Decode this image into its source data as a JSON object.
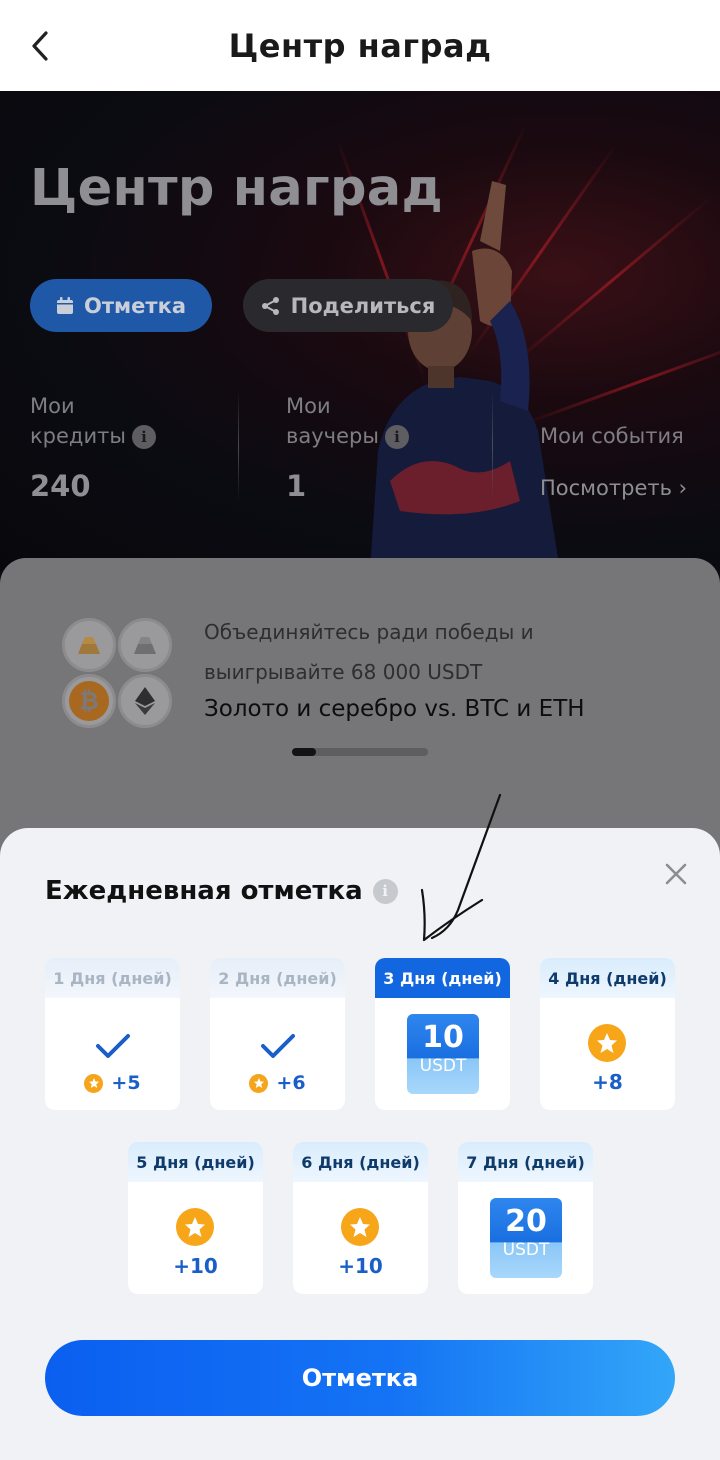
{
  "topbar": {
    "title": "Центр наград"
  },
  "hero": {
    "title": "Центр наград",
    "checkin_label": "Отметка",
    "share_label": "Поделиться",
    "credits": {
      "label_line1": "Мои",
      "label_line2": "кредиты",
      "value": "240"
    },
    "vouchers": {
      "label_line1": "Мои",
      "label_line2": "ваучеры",
      "value": "1"
    },
    "events": {
      "label": "Мои события",
      "link": "Посмотреть ›"
    }
  },
  "promo": {
    "subtitle_line1": "Объединяйтесь ради победы и",
    "subtitle_line2": "выигрывайте 68 000 USDT",
    "title": "Золото и серебро vs. BTC и ETH"
  },
  "daily_checkin": {
    "title": "Ежедневная отметка",
    "days": [
      {
        "label": "1 Дня (дней)",
        "status": "claimed",
        "reward": "+5"
      },
      {
        "label": "2 Дня (дней)",
        "status": "claimed",
        "reward": "+6"
      },
      {
        "label": "3 Дня (дней)",
        "status": "today",
        "reward_amount": "10",
        "reward_currency": "USDT"
      },
      {
        "label": "4 Дня (дней)",
        "status": "upcoming",
        "reward": "+8"
      },
      {
        "label": "5 Дня (дней)",
        "status": "upcoming",
        "reward": "+10"
      },
      {
        "label": "6 Дня (дней)",
        "status": "upcoming",
        "reward": "+10"
      },
      {
        "label": "7 Дня (дней)",
        "status": "upcoming",
        "reward_amount": "20",
        "reward_currency": "USDT"
      }
    ],
    "button_label": "Отметка"
  },
  "colors": {
    "accent": "#1266e0",
    "star": "#f7a61a",
    "reward_text": "#1a5fc8"
  }
}
